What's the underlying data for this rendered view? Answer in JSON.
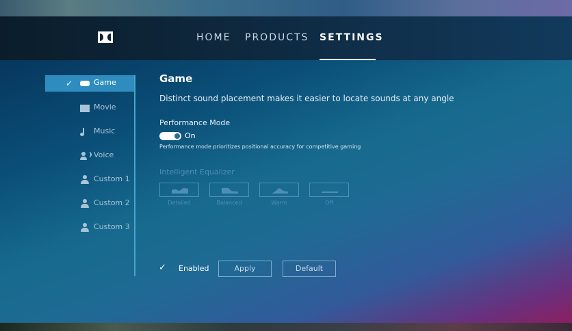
{
  "nav": {
    "links": [
      "HOME",
      "PRODUCTS",
      "SETTINGS"
    ],
    "active": "SETTINGS"
  },
  "sidebar": {
    "items": [
      {
        "label": "Game",
        "icon": "gamepad-icon",
        "active": true
      },
      {
        "label": "Movie",
        "icon": "film-icon",
        "active": false
      },
      {
        "label": "Music",
        "icon": "music-note-icon",
        "active": false
      },
      {
        "label": "Voice",
        "icon": "voice-icon",
        "active": false
      },
      {
        "label": "Custom 1",
        "icon": "user-icon",
        "active": false
      },
      {
        "label": "Custom 2",
        "icon": "user-icon",
        "active": false
      },
      {
        "label": "Custom 3",
        "icon": "user-icon",
        "active": false
      }
    ]
  },
  "content": {
    "title": "Game",
    "description": "Distinct sound placement makes it easier to locate sounds at any angle",
    "performance_label": "Performance Mode",
    "toggle_state": "On",
    "performance_note": "Performance mode prioritizes positional accuracy for competitive gaming",
    "equalizer_label": "Intelligent Equalizer",
    "equalizer_options": [
      "Detailed",
      "Balanced",
      "Warm",
      "Off"
    ]
  },
  "footer": {
    "enabled_label": "Enabled",
    "apply_label": "Apply",
    "default_label": "Default"
  },
  "colors": {
    "accent": "#2f8cbe",
    "disabled": "#4f8fb6"
  }
}
